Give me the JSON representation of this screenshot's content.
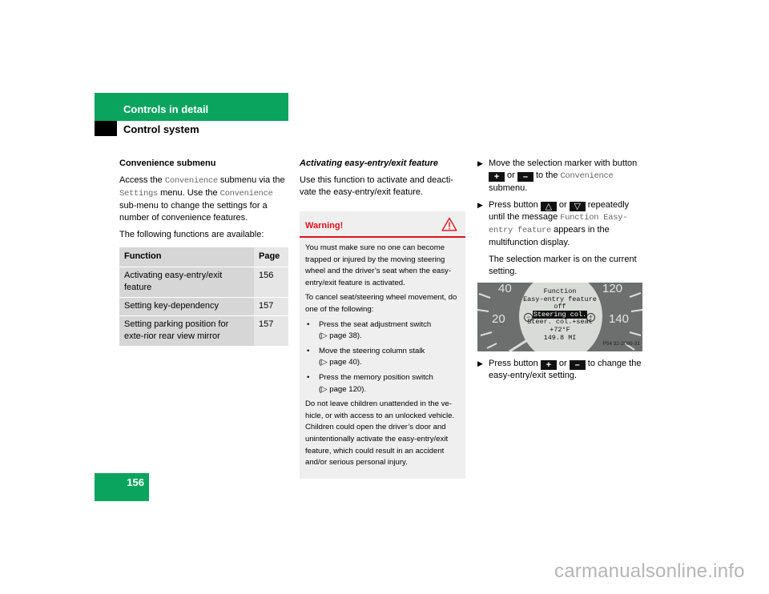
{
  "header": {
    "section_title": "Controls in detail",
    "subsection_title": "Control system"
  },
  "left": {
    "heading": "Convenience submenu",
    "para1_part1": "Access the ",
    "para1_mono1": "Convenience",
    "para1_part2": " submenu via the ",
    "para1_mono2": "Settings",
    "para1_part3": " menu. Use the ",
    "para1_mono3": "Convenience",
    "para1_part4": " sub-menu to change the settings for a number of convenience features.",
    "para2": "The following functions are available:",
    "table": {
      "headers": [
        "Function",
        "Page"
      ],
      "rows": [
        {
          "function": "Activating easy-entry/exit feature",
          "page": "156"
        },
        {
          "function": "Setting key-dependency",
          "page": "157"
        },
        {
          "function": "Setting parking position for exte-rior rear view mirror",
          "page": "157"
        }
      ]
    }
  },
  "middle": {
    "heading": "Activating easy-entry/exit feature",
    "intro": "Use this function to activate and deacti-vate the easy-entry/exit feature.",
    "warning": {
      "title": "Warning!",
      "icon": "warning-triangle-icon",
      "p1": "You must make sure no one can become trapped or injured by the moving steering wheel and the driver’s seat when the easy-entry/exit feature is activated.",
      "p2": "To cancel seat/steering wheel movement, do one of the following:",
      "bullets": [
        {
          "text": "Press the seat adjustment switch",
          "ref": "(▷ page 38)."
        },
        {
          "text": "Move the steering column stalk",
          "ref": "(▷ page 40)."
        },
        {
          "text": "Press the memory position switch",
          "ref": "(▷ page 120)."
        }
      ],
      "p3": "Do not leave children unattended in the ve-hicle, or with access to an unlocked vehicle. Children could open the driver’s door and unintentionally activate the easy-entry/exit feature, which could result in an accident and/or serious personal injury."
    }
  },
  "right": {
    "step1": {
      "a": "Move the selection marker with button ",
      "key1": "+",
      "or": " or ",
      "key2": "–",
      "b": " to the ",
      "mono": "Convenience",
      "c": " submenu."
    },
    "step2": {
      "a": "Press button ",
      "key1": "△",
      "or": " or ",
      "key2": "▽",
      "b": " repeatedly until the message ",
      "mono": "Function Easy-entry feature",
      "c": " appears in the multifunction display."
    },
    "note": "The selection marker is on the current setting.",
    "display": {
      "line1": "Function",
      "line2": "Easy-entry feature",
      "line3": "off",
      "line4_selected": "Steering col.",
      "line5": "Steer. col.+seat",
      "line6": "+72°F",
      "line7": "149.8 MI",
      "minus": "−",
      "plus": "+",
      "gauge_left": [
        "40",
        "20"
      ],
      "gauge_right": [
        "120",
        "140"
      ],
      "ref": "P54 32-2089-31"
    },
    "step3": {
      "a": "Press button ",
      "key1": "+",
      "or": " or ",
      "key2": "–",
      "b": " to change the easy-entry/exit setting."
    }
  },
  "page_number": "156",
  "watermark": "carmanualsonline.info"
}
